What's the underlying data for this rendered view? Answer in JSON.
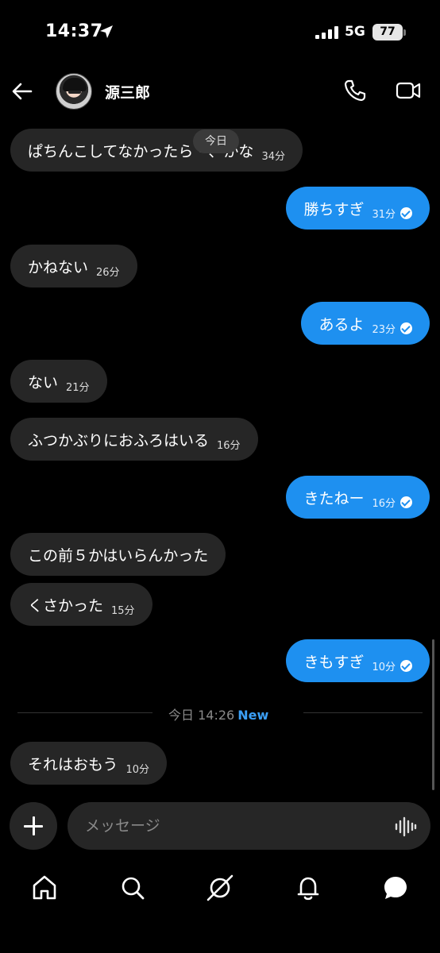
{
  "status_bar": {
    "time": "14:37",
    "network": "5G",
    "battery": "77"
  },
  "header": {
    "contact_name": "源三郎",
    "icons": [
      "back-arrow-icon",
      "phone-icon",
      "video-call-icon"
    ]
  },
  "chat": {
    "date_pill": "今日",
    "messages": [
      {
        "direction": "in",
        "text": "ぱちんこしてなかったら・、かな",
        "time": "34分"
      },
      {
        "direction": "out",
        "text": "勝ちすぎ",
        "time": "31分"
      },
      {
        "direction": "in",
        "text": "かねない",
        "time": "26分"
      },
      {
        "direction": "out",
        "text": "あるよ",
        "time": "23分"
      },
      {
        "direction": "in",
        "text": "ない",
        "time": "21分"
      },
      {
        "direction": "in",
        "text": "ふつかぶりにおふろはいる",
        "time": "16分"
      },
      {
        "direction": "out",
        "text": "きたねー",
        "time": "16分"
      },
      {
        "direction": "in",
        "text": "この前５かはいらんかった",
        "time": ""
      },
      {
        "direction": "in",
        "text": "くさかった",
        "time": "15分"
      },
      {
        "direction": "out",
        "text": "きもすぎ",
        "time": "10分"
      },
      {
        "direction": "in",
        "text": "それはおもう",
        "time": "10分"
      }
    ],
    "divider": {
      "label": "今日 14:26",
      "new_label": "New"
    }
  },
  "composer": {
    "placeholder": "メッセージ"
  },
  "bottom_nav": {
    "items": [
      "home-icon",
      "search-icon",
      "explore-icon",
      "notifications-icon",
      "messages-icon"
    ]
  },
  "colors": {
    "background": "#000000",
    "incoming_bubble": "#262626",
    "outgoing_bubble": "#1e90f0",
    "accent": "#3b9ff5"
  }
}
